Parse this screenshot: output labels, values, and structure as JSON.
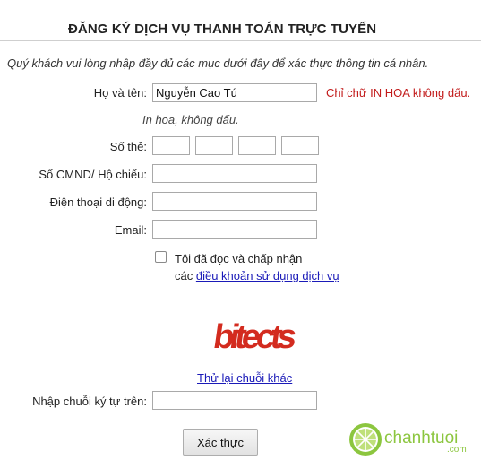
{
  "page": {
    "title": "ĐĂNG KÝ DỊCH VỤ THANH TOÁN TRỰC TUYẾN",
    "intro": "Quý khách vui lòng nhập đầy đủ các mục dưới đây để xác thực thông tin cá nhân."
  },
  "form": {
    "fullname": {
      "label": "Họ và tên:",
      "value": "Nguyễn Cao Tú",
      "requirement": "Chỉ chữ IN HOA không dấu.",
      "hint": "In hoa, không dấu."
    },
    "card": {
      "label": "Số thẻ:",
      "segments": [
        "",
        "",
        "",
        ""
      ]
    },
    "idcard": {
      "label": "Số CMND/ Hộ chiếu:",
      "value": ""
    },
    "phone": {
      "label": "Điện thoại di động:",
      "value": ""
    },
    "email": {
      "label": "Email:",
      "value": ""
    },
    "agree": {
      "checked": false,
      "line1": "Tôi đã đọc và chấp nhận",
      "prefix": "các",
      "link_text": "điều khoản sử dụng dịch vụ"
    },
    "captcha": {
      "text": "bitects",
      "retry_link": "Thử lại chuỗi khác",
      "input_label": "Nhập chuỗi ký tự trên:",
      "value": ""
    },
    "submit_label": "Xác thực"
  },
  "logo": {
    "name": "chanhtuoi",
    "suffix": ".com",
    "icon": "lime-slice-icon",
    "color": "#8cc63f"
  },
  "colors": {
    "required_text": "#c21b1b",
    "link": "#1a1ab8",
    "captcha": "#d32b1f"
  }
}
